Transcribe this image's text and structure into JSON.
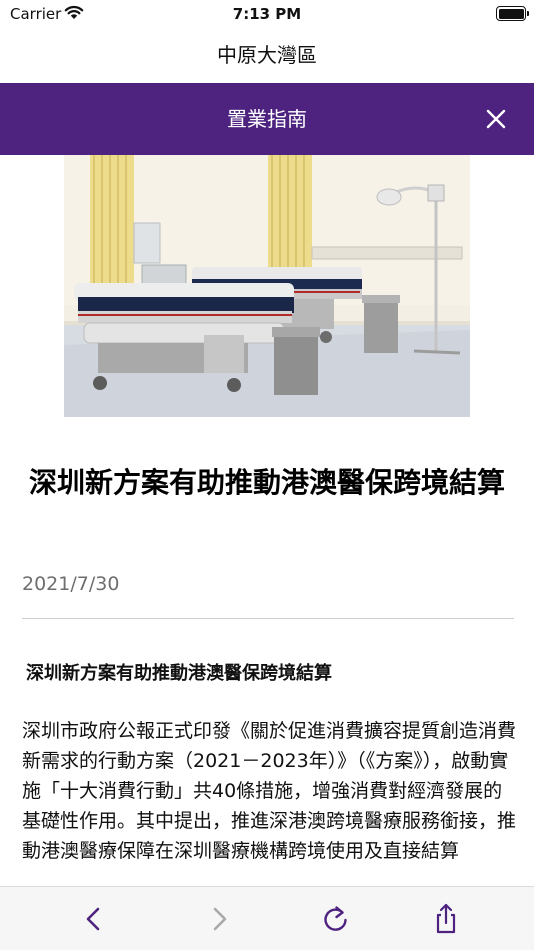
{
  "status_bar": {
    "carrier": "Carrier",
    "time": "7:13 PM"
  },
  "app": {
    "title": "中原大灣區"
  },
  "header": {
    "title": "置業指南"
  },
  "article": {
    "title": "深圳新方案有助推動港澳醫保跨境結算",
    "date": "2021/7/30",
    "subtitle": "深圳新方案有助推動港澳醫保跨境結算",
    "body": "深圳市政府公報正式印發《關於促進消費擴容提質創造消費新需求的行動方案（2021－2023年）》（《方案》），啟動實施「十大消費行動」共40條措施，增強消費對經濟發展的基礎性作用。其中提出，推進深港澳跨境醫療服務銜接，推動港澳醫療保障在深圳醫療機構跨境使用及直接結算"
  },
  "icons": {
    "wifi": "wifi-icon",
    "battery": "battery-icon",
    "close": "close-icon",
    "back": "chevron-left-icon",
    "forward": "chevron-right-icon",
    "reload": "reload-icon",
    "share": "share-icon"
  },
  "colors": {
    "header_bg": "#4e2380",
    "accent": "#4e2380",
    "disabled": "#a9a9a9"
  }
}
